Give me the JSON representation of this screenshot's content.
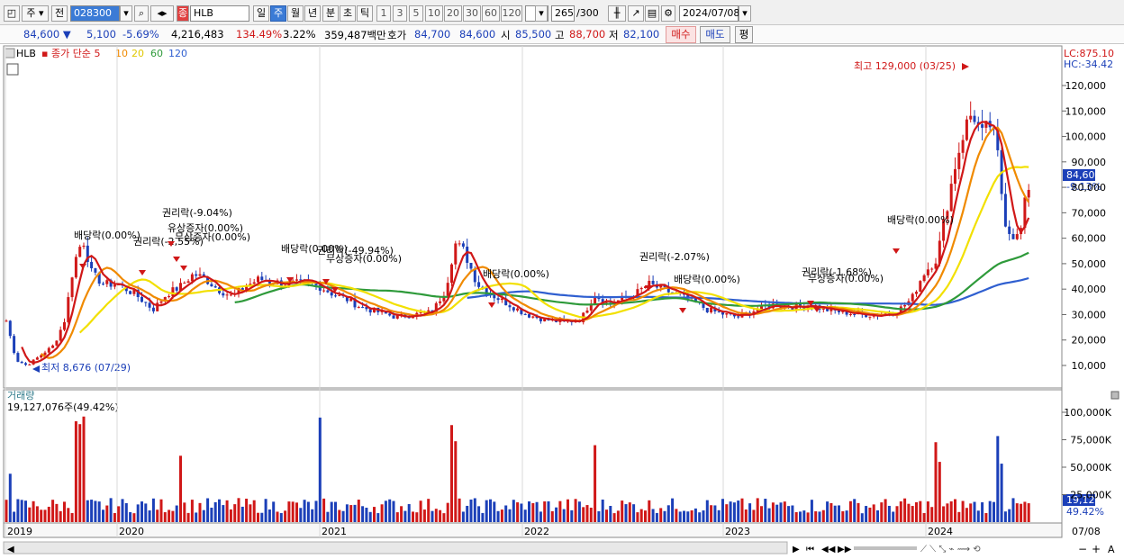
{
  "toolbar": {
    "period_selected": "주",
    "prev_label": "전",
    "code": "028300",
    "stock_name": "HLB",
    "stock_badge": "종",
    "periods": [
      "일",
      "주",
      "월",
      "년",
      "분",
      "초",
      "틱"
    ],
    "active_period": "주",
    "intervals": [
      "1",
      "3",
      "5",
      "10",
      "20",
      "30",
      "60",
      "120"
    ],
    "count": "265",
    "count_max": "/300",
    "date": "2024/07/08"
  },
  "quote": {
    "price": "84,600",
    "change": "5,100",
    "change_pct": "-5.69%",
    "volume": "4,216,483",
    "volume_ratio": "134.49%",
    "turnover": "3.22%",
    "amount": "359,487백만",
    "bid_label": "호가",
    "bid1": "84,700",
    "bid2": "84,600",
    "open_label": "시",
    "open": "85,500",
    "high_label": "고",
    "high": "88,700",
    "low_label": "저",
    "low": "82,100",
    "buy_label": "매수",
    "sell_label": "매도",
    "flat_label": "평"
  },
  "legend": {
    "symbol": "HLB",
    "series_label": "종가 단순",
    "ma5": "5",
    "ma10": "10",
    "ma20": "20",
    "ma60": "60",
    "ma120": "120"
  },
  "colors": {
    "up": "#d01818",
    "down": "#1b3fb8",
    "ma5": "#d01818",
    "ma10": "#f08a00",
    "ma20": "#f2e000",
    "ma60": "#2e9a3a",
    "ma120": "#2f5fd0"
  },
  "chart_data": {
    "type": "candlestick",
    "y_ticks": [
      "120,000",
      "110,000",
      "100,000",
      "90,000",
      "80,000",
      "70,000",
      "60,000",
      "50,000",
      "40,000",
      "30,000",
      "20,000",
      "10,000"
    ],
    "x_labels": [
      "2019",
      "2020",
      "2021",
      "2022",
      "2023",
      "2024",
      "07/08"
    ],
    "lc": "LC:875.10",
    "hc": "HC:-34.42",
    "current_price": "84,600",
    "current_pct": "-9.13%",
    "high_note": "최고 129,000 (03/25)",
    "low_note": "최저 8,676 (07/29)",
    "events": [
      {
        "label": "배당락(0.00%)"
      },
      {
        "label": "권리락(-2,55%)"
      },
      {
        "label": "권리락(-9.04%)"
      },
      {
        "label": "유상증자(0.00%)"
      },
      {
        "label": "무상증자(0.00%)"
      },
      {
        "label": "배당락(0.00%)"
      },
      {
        "label": "권리락(-49.94%)"
      },
      {
        "label": "무상증자(0.00%)"
      },
      {
        "label": "배당락(0.00%)"
      },
      {
        "label": "권리락(-2.07%)"
      },
      {
        "label": "배당락(0.00%)"
      },
      {
        "label": "권리락(-1.68%)"
      },
      {
        "label": "무상증자(0.00%)"
      },
      {
        "label": "배당락(0.00%)"
      }
    ],
    "volume": {
      "title": "거래량",
      "value": "19,127,076주(49.42%)",
      "ticks": [
        "100,000K",
        "75,000K",
        "50,000K",
        "25,000K"
      ],
      "current": "19,127K",
      "current_pct": "49.42%"
    }
  }
}
